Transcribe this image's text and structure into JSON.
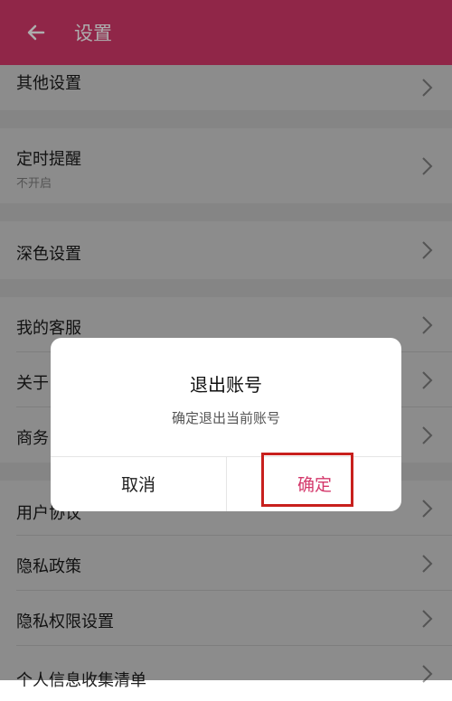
{
  "header": {
    "title": "设置",
    "back_icon": "arrow-left-icon",
    "color": "#d4386b"
  },
  "items": [
    {
      "label": "其他设置"
    },
    {
      "label": "定时提醒",
      "sub": "不开启"
    },
    {
      "label": "深色设置"
    },
    {
      "label": "我的客服"
    },
    {
      "label": "关于"
    },
    {
      "label": "商务"
    },
    {
      "label": "用户协议"
    },
    {
      "label": "隐私政策"
    },
    {
      "label": "隐私权限设置"
    },
    {
      "label": "个人信息收集清单"
    }
  ],
  "dialog": {
    "title": "退出账号",
    "message": "确定退出当前账号",
    "cancel_label": "取消",
    "confirm_label": "确定"
  },
  "colors": {
    "accent": "#d4386b",
    "highlight_box": "#c8201d"
  }
}
